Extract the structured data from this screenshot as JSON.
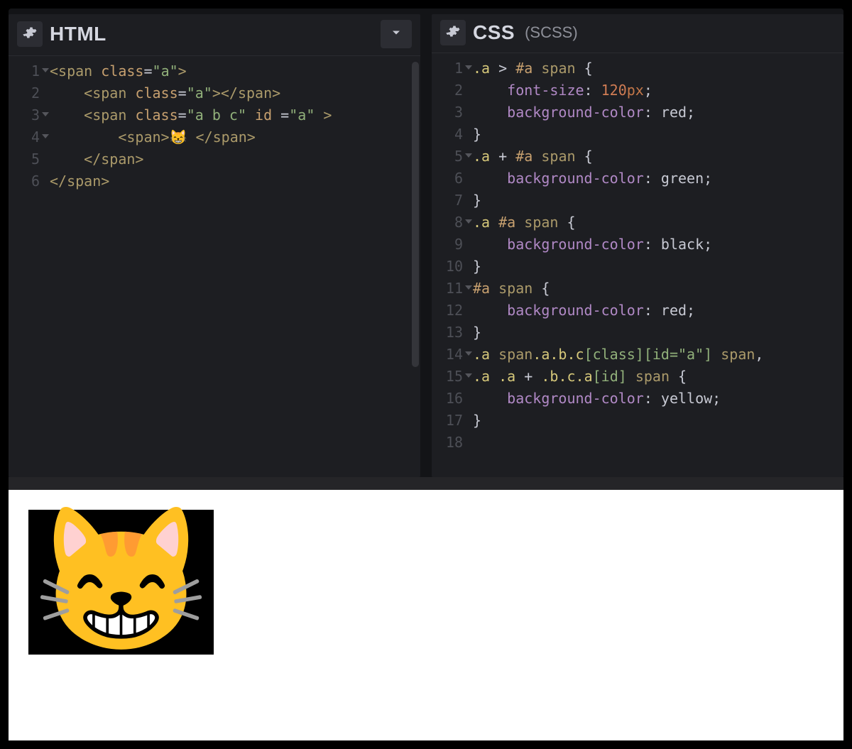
{
  "panels": {
    "html": {
      "title": "HTML",
      "sub": "",
      "lines": [
        {
          "n": 1,
          "fold": true,
          "tokens": [
            [
              "tag",
              "<span"
            ],
            [
              "punct",
              " "
            ],
            [
              "attrn",
              "class"
            ],
            [
              "punct",
              "="
            ],
            [
              "attrv",
              "\"a\""
            ],
            [
              "tag",
              ">"
            ]
          ]
        },
        {
          "n": 2,
          "fold": false,
          "indent": "    ",
          "tokens": [
            [
              "tag",
              "<span"
            ],
            [
              "punct",
              " "
            ],
            [
              "attrn",
              "class"
            ],
            [
              "punct",
              "="
            ],
            [
              "attrv",
              "\"a\""
            ],
            [
              "tag",
              ">"
            ],
            [
              "tag",
              "</span>"
            ]
          ]
        },
        {
          "n": 3,
          "fold": true,
          "indent": "    ",
          "tokens": [
            [
              "tag",
              "<span"
            ],
            [
              "punct",
              " "
            ],
            [
              "attrn",
              "class"
            ],
            [
              "punct",
              "="
            ],
            [
              "attrv",
              "\"a b c\""
            ],
            [
              "punct",
              " "
            ],
            [
              "attrn",
              "id"
            ],
            [
              "punct",
              " ="
            ],
            [
              "attrv",
              "\"a\""
            ],
            [
              "punct",
              " "
            ],
            [
              "tag",
              ">"
            ]
          ]
        },
        {
          "n": 4,
          "fold": true,
          "indent": "        ",
          "tokens": [
            [
              "tag",
              "<span>"
            ],
            [
              "punct",
              "😸 "
            ],
            [
              "tag",
              "</span>"
            ]
          ]
        },
        {
          "n": 5,
          "fold": false,
          "indent": "    ",
          "tokens": [
            [
              "tag",
              "</span>"
            ]
          ]
        },
        {
          "n": 6,
          "fold": false,
          "tokens": [
            [
              "tag",
              "</span>"
            ]
          ]
        }
      ]
    },
    "css": {
      "title": "CSS",
      "sub": "(SCSS)",
      "lines": [
        {
          "n": 1,
          "fold": true,
          "tokens": [
            [
              "sel-cls",
              ".a"
            ],
            [
              "op",
              " > "
            ],
            [
              "sel-id",
              "#a"
            ],
            [
              "op",
              " "
            ],
            [
              "sel-el",
              "span"
            ],
            [
              "op",
              " "
            ],
            [
              "brace",
              "{"
            ]
          ]
        },
        {
          "n": 2,
          "indent": "    ",
          "tokens": [
            [
              "prop",
              "font-size"
            ],
            [
              "punct",
              ": "
            ],
            [
              "num",
              "120"
            ],
            [
              "unit",
              "px"
            ],
            [
              "punct",
              ";"
            ]
          ]
        },
        {
          "n": 3,
          "indent": "    ",
          "tokens": [
            [
              "prop",
              "background-color"
            ],
            [
              "punct",
              ": "
            ],
            [
              "kw",
              "red"
            ],
            [
              "punct",
              ";"
            ]
          ]
        },
        {
          "n": 4,
          "tokens": [
            [
              "brace",
              "}"
            ]
          ]
        },
        {
          "n": 5,
          "fold": true,
          "tokens": [
            [
              "sel-cls",
              ".a"
            ],
            [
              "op",
              " + "
            ],
            [
              "sel-id",
              "#a"
            ],
            [
              "op",
              " "
            ],
            [
              "sel-el",
              "span"
            ],
            [
              "op",
              " "
            ],
            [
              "brace",
              "{"
            ]
          ]
        },
        {
          "n": 6,
          "indent": "    ",
          "tokens": [
            [
              "prop",
              "background-color"
            ],
            [
              "punct",
              ": "
            ],
            [
              "kw",
              "green"
            ],
            [
              "punct",
              ";"
            ]
          ]
        },
        {
          "n": 7,
          "tokens": [
            [
              "brace",
              "}"
            ]
          ]
        },
        {
          "n": 8,
          "fold": true,
          "tokens": [
            [
              "sel-cls",
              ".a"
            ],
            [
              "op",
              " "
            ],
            [
              "sel-id",
              "#a"
            ],
            [
              "op",
              " "
            ],
            [
              "sel-el",
              "span"
            ],
            [
              "op",
              " "
            ],
            [
              "brace",
              "{"
            ]
          ]
        },
        {
          "n": 9,
          "indent": "    ",
          "tokens": [
            [
              "prop",
              "background-color"
            ],
            [
              "punct",
              ": "
            ],
            [
              "kw",
              "black"
            ],
            [
              "punct",
              ";"
            ]
          ]
        },
        {
          "n": 10,
          "tokens": [
            [
              "brace",
              "}"
            ]
          ]
        },
        {
          "n": 11,
          "fold": true,
          "tokens": [
            [
              "sel-id",
              "#a"
            ],
            [
              "op",
              " "
            ],
            [
              "sel-el",
              "span"
            ],
            [
              "op",
              " "
            ],
            [
              "brace",
              "{"
            ]
          ]
        },
        {
          "n": 12,
          "indent": "    ",
          "tokens": [
            [
              "prop",
              "background-color"
            ],
            [
              "punct",
              ": "
            ],
            [
              "kw",
              "red"
            ],
            [
              "punct",
              ";"
            ]
          ]
        },
        {
          "n": 13,
          "tokens": [
            [
              "brace",
              "}"
            ]
          ]
        },
        {
          "n": 14,
          "fold": true,
          "tokens": [
            [
              "sel-cls",
              ".a"
            ],
            [
              "op",
              " "
            ],
            [
              "sel-el",
              "span"
            ],
            [
              "sel-cls",
              ".a.b.c"
            ],
            [
              "sel-attr",
              "[class][id=\"a\"]"
            ],
            [
              "op",
              " "
            ],
            [
              "sel-el",
              "span"
            ],
            [
              "punct",
              ","
            ]
          ]
        },
        {
          "n": 15,
          "fold": true,
          "tokens": [
            [
              "sel-cls",
              ".a"
            ],
            [
              "op",
              " "
            ],
            [
              "sel-cls",
              ".a"
            ],
            [
              "op",
              " + "
            ],
            [
              "sel-cls",
              ".b.c.a"
            ],
            [
              "sel-attr",
              "[id]"
            ],
            [
              "op",
              " "
            ],
            [
              "sel-el",
              "span"
            ],
            [
              "op",
              " "
            ],
            [
              "brace",
              "{"
            ]
          ]
        },
        {
          "n": 16,
          "indent": "    ",
          "tokens": [
            [
              "prop",
              "background-color"
            ],
            [
              "punct",
              ": "
            ],
            [
              "kw",
              "yellow"
            ],
            [
              "punct",
              ";"
            ]
          ]
        },
        {
          "n": 17,
          "tokens": [
            [
              "brace",
              "}"
            ]
          ]
        },
        {
          "n": 18,
          "tokens": []
        }
      ]
    }
  },
  "output": {
    "emoji": "😸"
  }
}
